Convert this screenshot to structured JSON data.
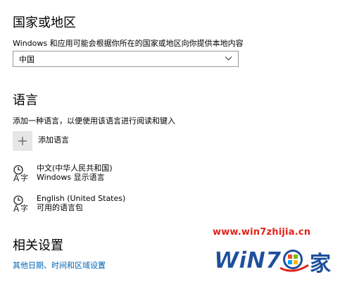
{
  "region": {
    "heading": "国家或地区",
    "description": "Windows 和应用可能会根据你所在的国家或地区向你提供本地内容",
    "selected_country": "中国"
  },
  "language": {
    "heading": "语言",
    "description": "添加一种语言，以便使用该语言进行阅读和键入",
    "add_label": "添加语言",
    "items": [
      {
        "name": "中文(中华人民共和国)",
        "status": "Windows 显示语言"
      },
      {
        "name": "English (United States)",
        "status": "可用的语言包"
      }
    ]
  },
  "related": {
    "heading": "相关设置",
    "link": "其他日期、时间和区域设置"
  },
  "watermark": {
    "url": "www.win7zhijia.cn",
    "logo_text": "WiN7",
    "logo_suffix": "家"
  },
  "colors": {
    "link": "#0063b1",
    "watermark_red": "#e2231a",
    "watermark_blue": "#1d4f9c"
  }
}
